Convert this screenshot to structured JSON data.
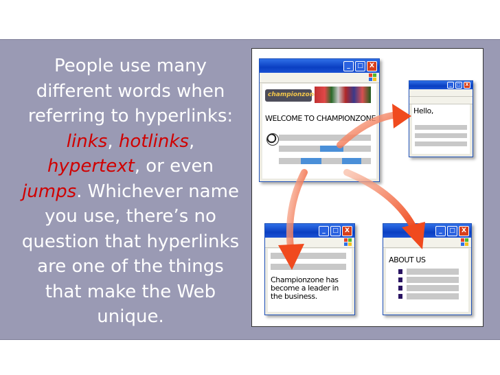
{
  "paragraph": {
    "part1": "People use many different words when referring to hyperlinks: ",
    "term1": "links",
    "sep1": ", ",
    "term2": "hotlinks",
    "sep2": ", ",
    "term3": "hypertext",
    "part2": ", or even ",
    "term4": "jumps",
    "part3": ". Whichever name you use, there’s no question that hyperlinks are one of the things that make the Web unique."
  },
  "diagram": {
    "main_window": {
      "logo_text": "championzone",
      "heading": "WELCOME TO CHAMPIONZONE"
    },
    "hello_window": {
      "text": "Hello,"
    },
    "news_window": {
      "text": "Championzone has become a leader in the business."
    },
    "about_window": {
      "heading": "ABOUT US"
    },
    "window_buttons": {
      "minimize": "_",
      "maximize": "□",
      "close": "X"
    }
  },
  "colors": {
    "band": "#9a9ab4",
    "text": "#ffffff",
    "highlight": "#d00000",
    "arrow": "#f04a1e"
  }
}
